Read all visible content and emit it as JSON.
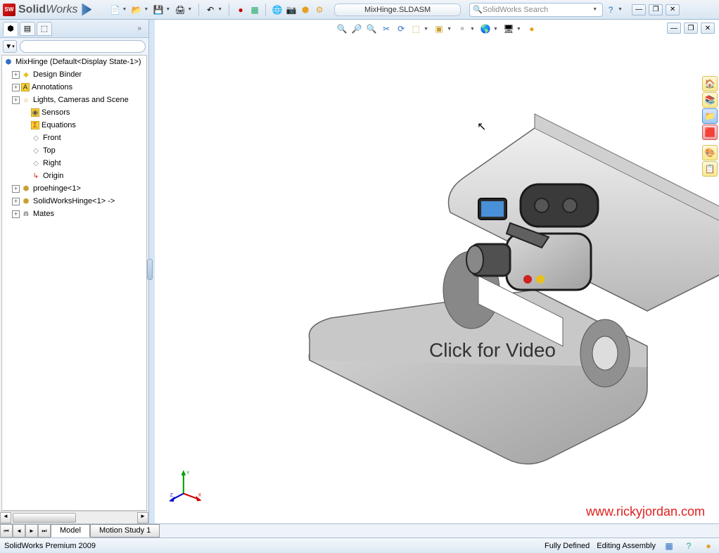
{
  "app": {
    "brand_bold": "Solid",
    "brand_rest": "Works"
  },
  "document_name": "MixHinge.SLDASM",
  "search_placeholder": "SolidWorks Search",
  "tree": {
    "root": "MixHinge  (Default<Display State-1>)",
    "items": [
      {
        "label": "Design Binder",
        "exp": "+",
        "icon": "◆",
        "color": "#e8c020"
      },
      {
        "label": "Annotations",
        "exp": "+",
        "icon": "A",
        "color": "#e8c020"
      },
      {
        "label": "Lights, Cameras and Scene",
        "exp": "+",
        "icon": "☼",
        "color": "#e8c020"
      },
      {
        "label": "Sensors",
        "exp": "",
        "icon": "◉",
        "color": "#60a060"
      },
      {
        "label": "Equations",
        "exp": "",
        "icon": "Σ",
        "color": "#e05030"
      },
      {
        "label": "Front",
        "exp": "",
        "icon": "◇",
        "color": "#888"
      },
      {
        "label": "Top",
        "exp": "",
        "icon": "◇",
        "color": "#888"
      },
      {
        "label": "Right",
        "exp": "",
        "icon": "◇",
        "color": "#888"
      },
      {
        "label": "Origin",
        "exp": "",
        "icon": "↳",
        "color": "#d02020"
      },
      {
        "label": "proehinge<1>",
        "exp": "+",
        "icon": "⬢",
        "color": "#c8a030"
      },
      {
        "label": "SolidWorksHinge<1> ->",
        "exp": "+",
        "icon": "⬢",
        "color": "#c8a030"
      },
      {
        "label": "Mates",
        "exp": "+",
        "icon": "⋒",
        "color": "#666"
      }
    ]
  },
  "bottom_tabs": {
    "tab1": "Model",
    "tab2": "Motion Study 1"
  },
  "status": {
    "left": "SolidWorks Premium 2009",
    "mid": "Fully Defined",
    "right": "Editing Assembly"
  },
  "overlay": "Click for Video",
  "watermark": "www.rickyjordan.com",
  "triad": {
    "x": "X",
    "y": "Y",
    "z": "Z"
  }
}
